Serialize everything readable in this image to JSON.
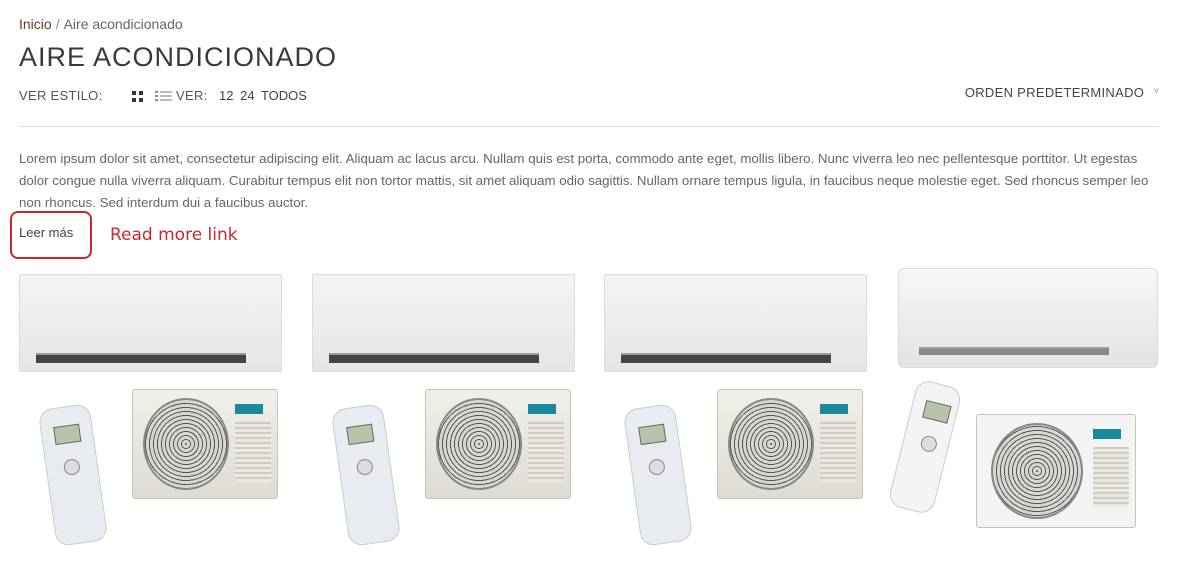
{
  "breadcrumb": {
    "home": "Inicio",
    "separator": "/",
    "current": "Aire acondicionado"
  },
  "page": {
    "title": "AIRE ACONDICIONADO"
  },
  "toolbar": {
    "view_style_label": "VER ESTILO:",
    "view_label": "VER:",
    "per_page_options": [
      "12",
      "24",
      "TODOS"
    ],
    "sort_label": "ORDEN PREDETERMINADO",
    "sort_chevron": "v",
    "view_icons": [
      "grid-view-icon",
      "list-view-icon"
    ]
  },
  "category": {
    "description": "Lorem ipsum dolor sit amet, consectetur adipiscing elit. Aliquam ac lacus arcu. Nullam quis est porta, commodo ante eget, mollis libero. Nunc viverra leo nec pellentesque porttitor. Ut egestas dolor congue nulla viverra aliquam. Curabitur tempus elit non tortor mattis, sit amet aliquam odio sagittis. Nullam ornare tempus ligula, in faucibus neque molestie eget. Sed rhoncus semper leo non rhoncus. Sed interdum dui a faucibus auctor.",
    "read_more": "Leer más"
  },
  "annotation": {
    "text": "Read more link",
    "color": "#c8282d"
  },
  "products": [
    {
      "image": "split-air-conditioner-set"
    },
    {
      "image": "split-air-conditioner-set"
    },
    {
      "image": "split-air-conditioner-set"
    },
    {
      "image": "split-air-conditioner-set"
    }
  ]
}
